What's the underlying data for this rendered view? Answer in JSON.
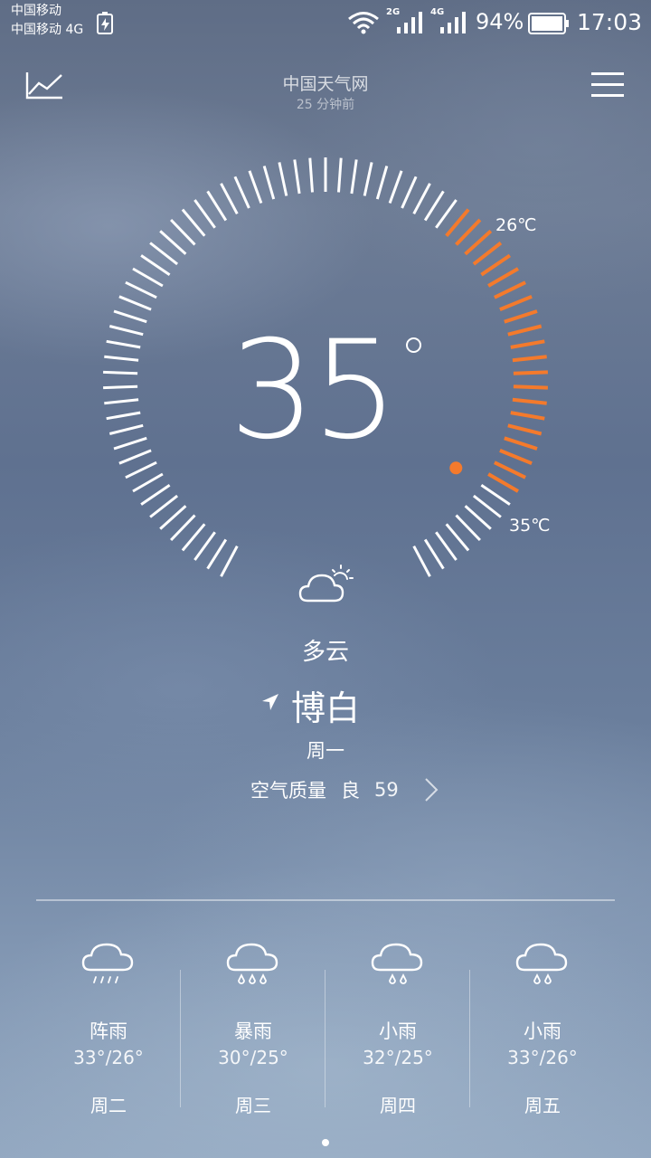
{
  "status_bar": {
    "carrier1": "中国移动",
    "carrier2": "中国移动 4G",
    "net1": "2G",
    "net2": "4G",
    "battery": "94%",
    "time": "17:03"
  },
  "header": {
    "source": "中国天气网",
    "updated": "25 分钟前"
  },
  "current": {
    "temperature": "35",
    "high_label": "26℃",
    "low_label": "35℃",
    "condition": "多云",
    "condition_icon": "partly-cloudy-icon",
    "location": "博白",
    "weekday": "周一",
    "air_quality_label": "空气质量",
    "air_quality_level": "良",
    "air_quality_value": "59"
  },
  "forecast": [
    {
      "condition": "阵雨",
      "range": "33°/26°",
      "weekday": "周二",
      "icon": "shower-icon"
    },
    {
      "condition": "暴雨",
      "range": "30°/25°",
      "weekday": "周三",
      "icon": "heavy-rain-icon"
    },
    {
      "condition": "小雨",
      "range": "32°/25°",
      "weekday": "周四",
      "icon": "light-rain-icon"
    },
    {
      "condition": "小雨",
      "range": "33°/26°",
      "weekday": "周五",
      "icon": "light-rain-icon"
    }
  ],
  "colors": {
    "accent": "#f47a2c",
    "text": "#ffffff"
  }
}
